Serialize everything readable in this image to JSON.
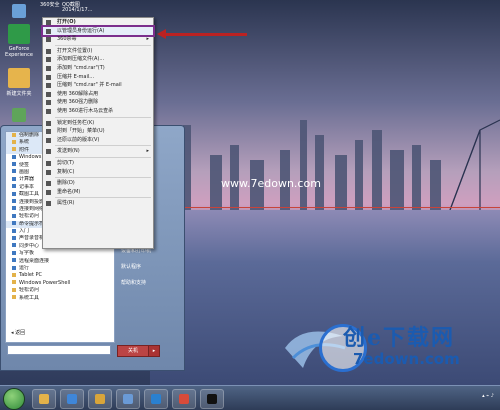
{
  "desktop": {
    "watermark_center": "www.7edown.com",
    "top_labels": [
      "360安全",
      "QQ截图",
      "2014/1/17..."
    ],
    "icons": [
      {
        "label": "GeForce Experience",
        "color": "#2f9a48"
      },
      {
        "label": "新建文件夹",
        "color": "#e6b44c"
      },
      {
        "label": "",
        "color": "#6aa0d8"
      },
      {
        "label": "",
        "color": "#5fa45a"
      }
    ],
    "logo": {
      "top_text": "创e下载网",
      "bottom_text": "7edown.com"
    }
  },
  "start_menu": {
    "programs": [
      {
        "label": "强制删除",
        "type": "folder",
        "selected": true
      },
      {
        "label": "系统",
        "type": "folder",
        "selected": true
      },
      {
        "label": "附件",
        "type": "folder",
        "selected": true
      },
      {
        "label": "Windows",
        "type": "app"
      },
      {
        "label": "便签",
        "type": "app"
      },
      {
        "label": "画图",
        "type": "app"
      },
      {
        "label": "计算器",
        "type": "app"
      },
      {
        "label": "记事本",
        "type": "app"
      },
      {
        "label": "截图工具",
        "type": "app"
      },
      {
        "label": "连接到投影仪",
        "type": "app"
      },
      {
        "label": "连接到网络投影仪",
        "type": "app"
      },
      {
        "label": "轻松访问",
        "type": "app"
      },
      {
        "label": "命令提示符",
        "type": "app",
        "selected": true
      },
      {
        "label": "入门",
        "type": "app"
      },
      {
        "label": "声音录音机",
        "type": "app"
      },
      {
        "label": "同步中心",
        "type": "app"
      },
      {
        "label": "写字板",
        "type": "app"
      },
      {
        "label": "远程桌面连接",
        "type": "app"
      },
      {
        "label": "运行",
        "type": "app"
      },
      {
        "label": "Tablet PC",
        "type": "folder"
      },
      {
        "label": "Windows PowerShell",
        "type": "folder"
      },
      {
        "label": "轻松访问",
        "type": "folder"
      },
      {
        "label": "系统工具",
        "type": "folder"
      }
    ],
    "back_label": "返回",
    "search_placeholder": "",
    "right_links": [
      "",
      "",
      "",
      "",
      "",
      "",
      "控制面板",
      "设备和打印机",
      "默认程序",
      "帮助和支持"
    ],
    "shutdown_label": "关机",
    "shutdown_arrow": "▸"
  },
  "context_menu": {
    "items": [
      {
        "label": "打开(O)",
        "type": "item",
        "bold": true
      },
      {
        "label": "以管理员身份运行(A)",
        "type": "item",
        "highlight": true
      },
      {
        "label": "360杀毒",
        "type": "item",
        "sub": "▸"
      },
      {
        "type": "sep"
      },
      {
        "label": "打开文件位置(I)",
        "type": "item"
      },
      {
        "label": "添加到压缩文件(A)...",
        "type": "item"
      },
      {
        "label": "添加到 \"cmd.rar\"(T)",
        "type": "item"
      },
      {
        "label": "压缩并 E-mail...",
        "type": "item"
      },
      {
        "label": "压缩到 \"cmd.rar\" 并 E-mail",
        "type": "item"
      },
      {
        "label": "使用 360解除占用",
        "type": "item"
      },
      {
        "label": "使用 360强力删除",
        "type": "item"
      },
      {
        "label": "使用 360进行木马云查杀",
        "type": "item"
      },
      {
        "type": "sep"
      },
      {
        "label": "锁定到任务栏(K)",
        "type": "item"
      },
      {
        "label": "附到「开始」菜单(U)",
        "type": "item"
      },
      {
        "label": "还原以前的版本(V)",
        "type": "item"
      },
      {
        "type": "sep"
      },
      {
        "label": "发送到(N)",
        "type": "item",
        "sub": "▸"
      },
      {
        "type": "sep"
      },
      {
        "label": "剪切(T)",
        "type": "item"
      },
      {
        "label": "复制(C)",
        "type": "item"
      },
      {
        "type": "sep"
      },
      {
        "label": "删除(D)",
        "type": "item"
      },
      {
        "label": "重命名(M)",
        "type": "item"
      },
      {
        "type": "sep"
      },
      {
        "label": "属性(R)",
        "type": "item"
      }
    ]
  },
  "taskbar": {
    "buttons": [
      {
        "name": "explorer",
        "color": "#e3b24a"
      },
      {
        "name": "ie",
        "color": "#3f86d8"
      },
      {
        "name": "folder",
        "color": "#d9a53a"
      },
      {
        "name": "media",
        "color": "#6a9ad6"
      },
      {
        "name": "app",
        "color": "#2a80d0"
      },
      {
        "name": "player",
        "color": "#d84b3a"
      },
      {
        "name": "cmd",
        "color": "#111111"
      }
    ]
  }
}
